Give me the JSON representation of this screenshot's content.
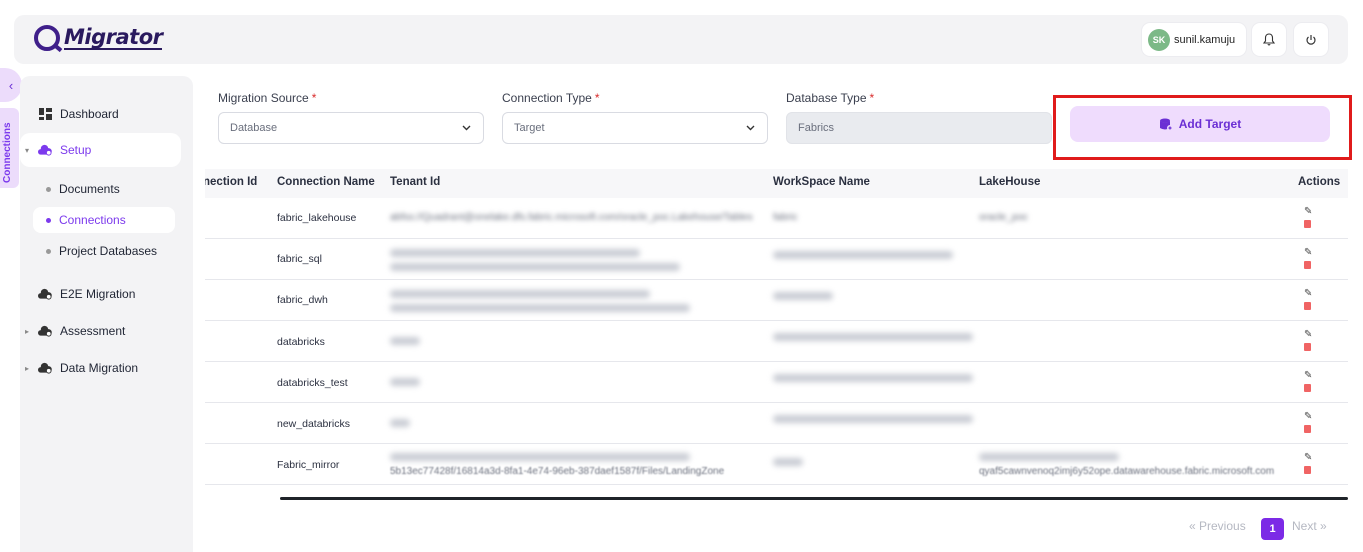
{
  "app": {
    "logo_text": "Migrator"
  },
  "header": {
    "user_initials": "SK",
    "user_name": "sunil.kamuju"
  },
  "side_tab": {
    "label": "Connections"
  },
  "sidebar": {
    "items": [
      {
        "label": "Dashboard"
      },
      {
        "label": "Setup"
      },
      {
        "label": "E2E Migration"
      },
      {
        "label": "Assessment"
      },
      {
        "label": "Data Migration"
      }
    ],
    "setup_children": [
      {
        "label": "Documents"
      },
      {
        "label": "Connections"
      },
      {
        "label": "Project Databases"
      }
    ]
  },
  "filters": {
    "migration_source": {
      "label": "Migration Source",
      "value": "Database"
    },
    "connection_type": {
      "label": "Connection Type",
      "value": "Target"
    },
    "database_type": {
      "label": "Database Type",
      "value": "Fabrics"
    },
    "required_mark": "*"
  },
  "add_target_label": "Add Target",
  "table": {
    "columns": [
      "nection Id",
      "Connection Name",
      "Tenant Id",
      "WorkSpace Name",
      "LakeHouse",
      "Actions"
    ],
    "rows": [
      {
        "name": "fabric_lakehouse",
        "tenant": "abfss://Quadrant@onelake.dfs.fabric.microsoft.com/oracle_poc.Lakehouse/Tables",
        "workspace": "fabric",
        "lakehouse": "oracle_poc"
      },
      {
        "name": "fabric_sql",
        "tenant": "",
        "workspace": "",
        "lakehouse": ""
      },
      {
        "name": "fabric_dwh",
        "tenant": "",
        "workspace": "",
        "lakehouse": ""
      },
      {
        "name": "databricks",
        "tenant": "",
        "workspace": "",
        "lakehouse": ""
      },
      {
        "name": "databricks_test",
        "tenant": "",
        "workspace": "",
        "lakehouse": ""
      },
      {
        "name": "new_databricks",
        "tenant": "",
        "workspace": "",
        "lakehouse": ""
      },
      {
        "name": "Fabric_mirror",
        "tenant": "5b13ec77428f/16814a3d-8fa1-4e74-96eb-387daef1587f/Files/LandingZone",
        "workspace": "",
        "lakehouse": "qyaf5cawnvenoq2imj6y52ope.datawarehouse.fabric.microsoft.com"
      }
    ]
  },
  "pagination": {
    "prev": "« Previous",
    "current": "1",
    "next": "Next »"
  },
  "colors": {
    "accent": "#7c3aed",
    "highlight": "#e01b1b",
    "add_target_bg": "#efdcfd"
  }
}
